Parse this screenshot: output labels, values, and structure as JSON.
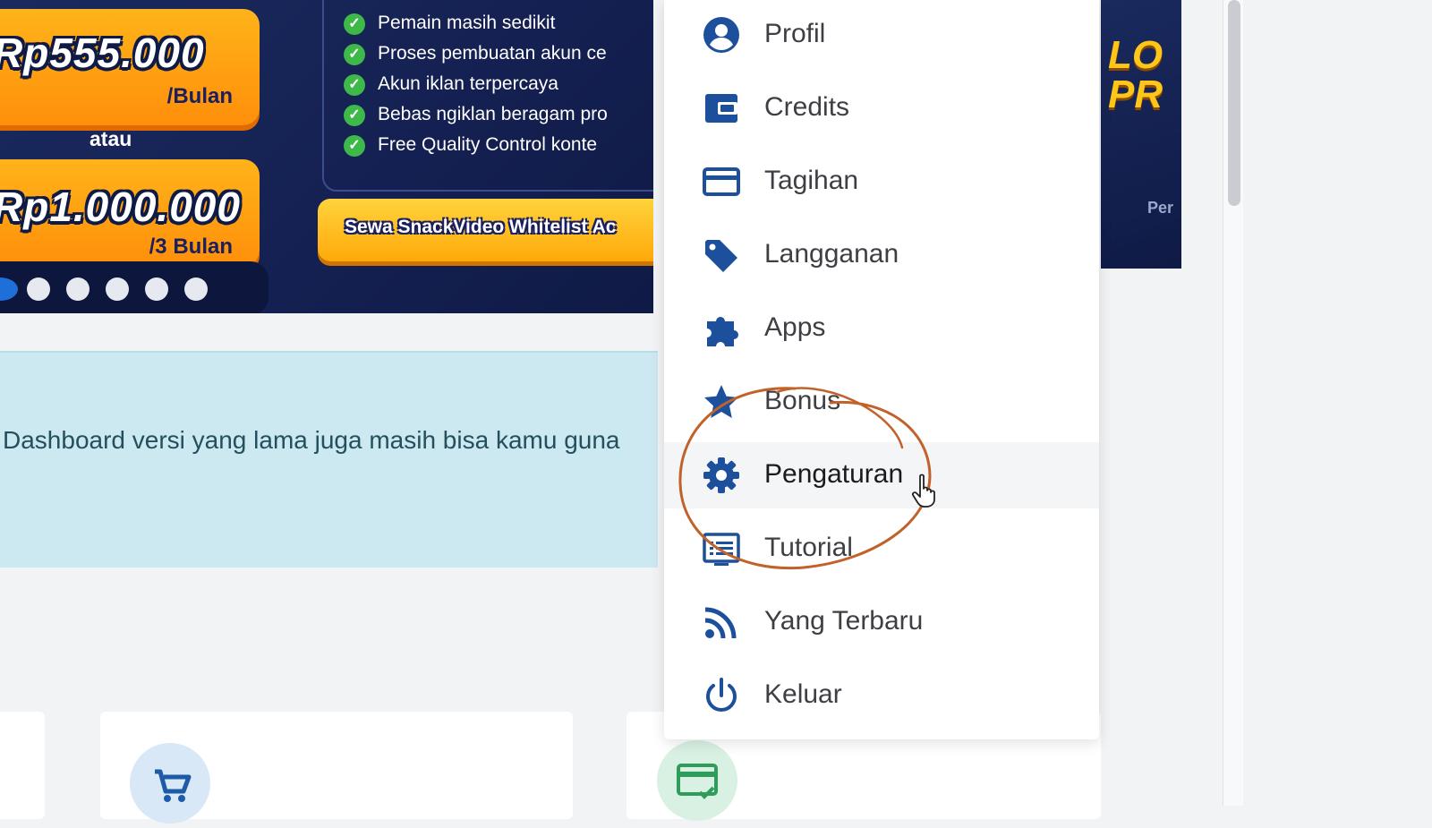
{
  "banner": {
    "price1": "Rp555.000",
    "price1_period": "/Bulan",
    "separator": "atau",
    "price2": "Rp1.000.000",
    "price2_period": "/3 Bulan",
    "features": [
      "Pemain masih sedikit",
      "Proses pembuatan akun ce",
      "Akun iklan terpercaya",
      "Bebas ngiklan beragam pro",
      "Free Quality Control konte"
    ],
    "cta_label": "Sewa SnackVideo Whitelist Ac",
    "carousel": {
      "active": 0,
      "total": 6
    },
    "colors": {
      "background": "#142051",
      "price_box": "#ff9d12",
      "cta": "#ffc21f",
      "check": "#3fb84a"
    }
  },
  "right_banner": {
    "big_text": "LO PR",
    "caption": "Per"
  },
  "notice": {
    "text": "Dashboard versi yang lama juga masih bisa kamu guna"
  },
  "cards": [
    {
      "icon": "cart-icon",
      "color": "#1e5aa8"
    },
    {
      "icon": "payment-check-icon",
      "color": "#2e9d5b"
    }
  ],
  "menu": {
    "accent": "#1c4f9c",
    "hovered_index": 6,
    "items": [
      {
        "label": "Profil",
        "icon": "user-circle-icon"
      },
      {
        "label": "Credits",
        "icon": "wallet-icon"
      },
      {
        "label": "Tagihan",
        "icon": "credit-card-icon"
      },
      {
        "label": "Langganan",
        "icon": "tag-icon"
      },
      {
        "label": "Apps",
        "icon": "puzzle-icon"
      },
      {
        "label": "Bonus",
        "icon": "star-icon"
      },
      {
        "label": "Pengaturan",
        "icon": "gear-icon"
      },
      {
        "label": "Tutorial",
        "icon": "tutorial-icon"
      },
      {
        "label": "Yang Terbaru",
        "icon": "rss-icon"
      },
      {
        "label": "Keluar",
        "icon": "power-icon"
      }
    ]
  },
  "annotation": {
    "type": "hand-drawn-circle",
    "color": "#c0622a",
    "target": "Pengaturan"
  }
}
